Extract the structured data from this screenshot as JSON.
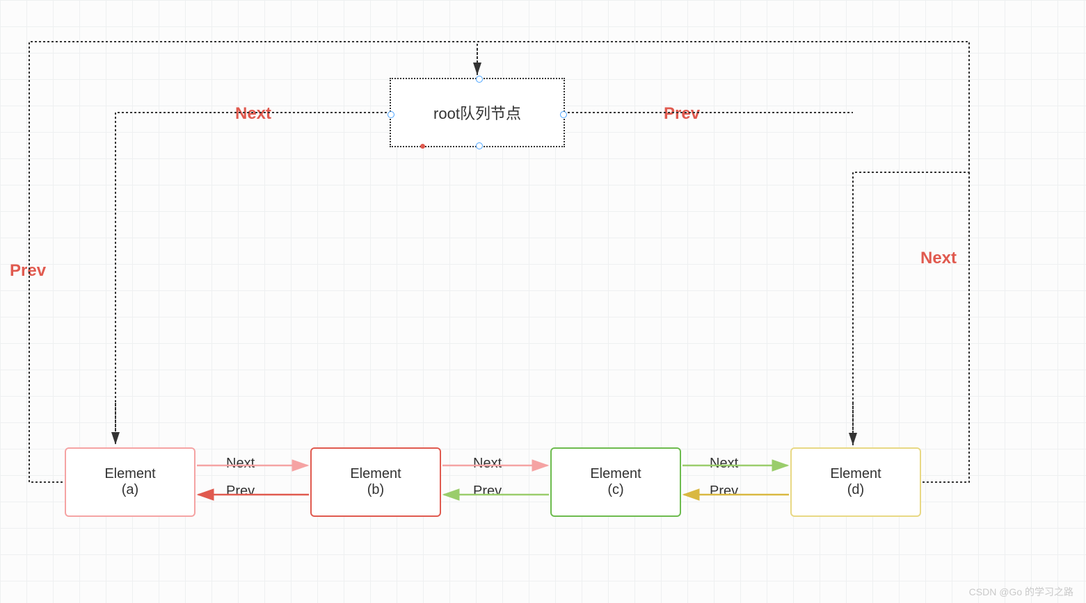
{
  "root": {
    "label": "root队列节点"
  },
  "elements": {
    "a": {
      "title": "Element",
      "sub": "(a)"
    },
    "b": {
      "title": "Element",
      "sub": "(b)"
    },
    "c": {
      "title": "Element",
      "sub": "(c)"
    },
    "d": {
      "title": "Element",
      "sub": "(d)"
    }
  },
  "labels": {
    "root_next": "Next",
    "root_prev": "Prev",
    "left_prev": "Prev",
    "right_next": "Next",
    "ab_next": "Next",
    "ab_prev": "Prev",
    "bc_next": "Next",
    "bc_prev": "Prev",
    "cd_next": "Next",
    "cd_prev": "Prev"
  },
  "watermark": "CSDN @Go 的学习之路",
  "colors": {
    "pink": "#f5a3a3",
    "red": "#e05a4f",
    "green_light": "#9acd6b",
    "green": "#6dbb4e",
    "yellow": "#d9b841",
    "yellow_light": "#e8d884"
  }
}
